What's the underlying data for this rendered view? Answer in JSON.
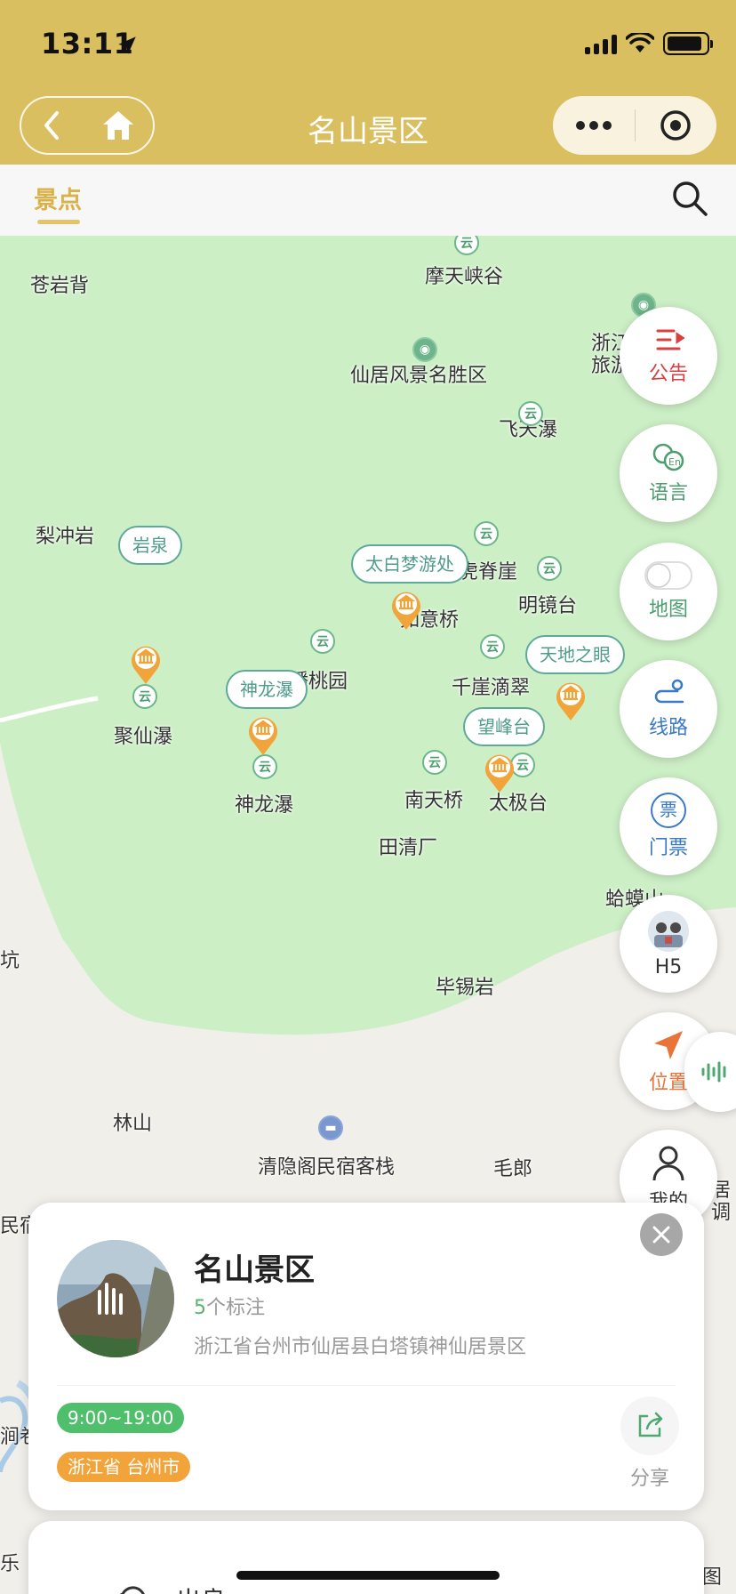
{
  "status_bar": {
    "time": "13:11"
  },
  "nav": {
    "title": "名山景区"
  },
  "tabs": {
    "active": "景点"
  },
  "map": {
    "labels": [
      "摩天峡谷",
      "苍岩背",
      "仙居风景名胜区",
      "飞天瀑",
      "浙江",
      "旅游",
      "梨冲岩",
      "虎脊崖",
      "明镜台",
      "如意桥",
      "蟠桃园",
      "千崖滴翠",
      "聚仙瀑",
      "神龙瀑",
      "南天桥",
      "太极台",
      "田清厂",
      "蛤蟆山",
      "坑",
      "毕锡岩",
      "林山",
      "清隐阁民宿客栈",
      "毛郎",
      "民宿",
      "调",
      "居",
      "涧卷",
      "图",
      "乐"
    ],
    "bubbles": [
      "太白梦游处",
      "岩泉",
      "神龙瀑",
      "天地之眼",
      "望峰台"
    ]
  },
  "fabs": {
    "notice": "公告",
    "language": "语言",
    "map": "地图",
    "route": "线路",
    "ticket": "门票",
    "ticket_glyph": "票",
    "h5": "H5",
    "location": "位置",
    "mine": "我的"
  },
  "card": {
    "name": "名山景区",
    "count_num": "5",
    "count_text": "个标注",
    "address": "浙江省台州市仙居县白塔镇神仙居景区",
    "hours": "9:00~19:00",
    "region": "浙江省 台州市",
    "share": "分享"
  },
  "card2": {
    "title": "出良"
  },
  "colors": {
    "header": "#d9bf60",
    "accent": "#d9b24a",
    "park_green": "#cdefc6",
    "poi_green": "#4d9e6e",
    "pin_orange": "#f0a43a"
  }
}
